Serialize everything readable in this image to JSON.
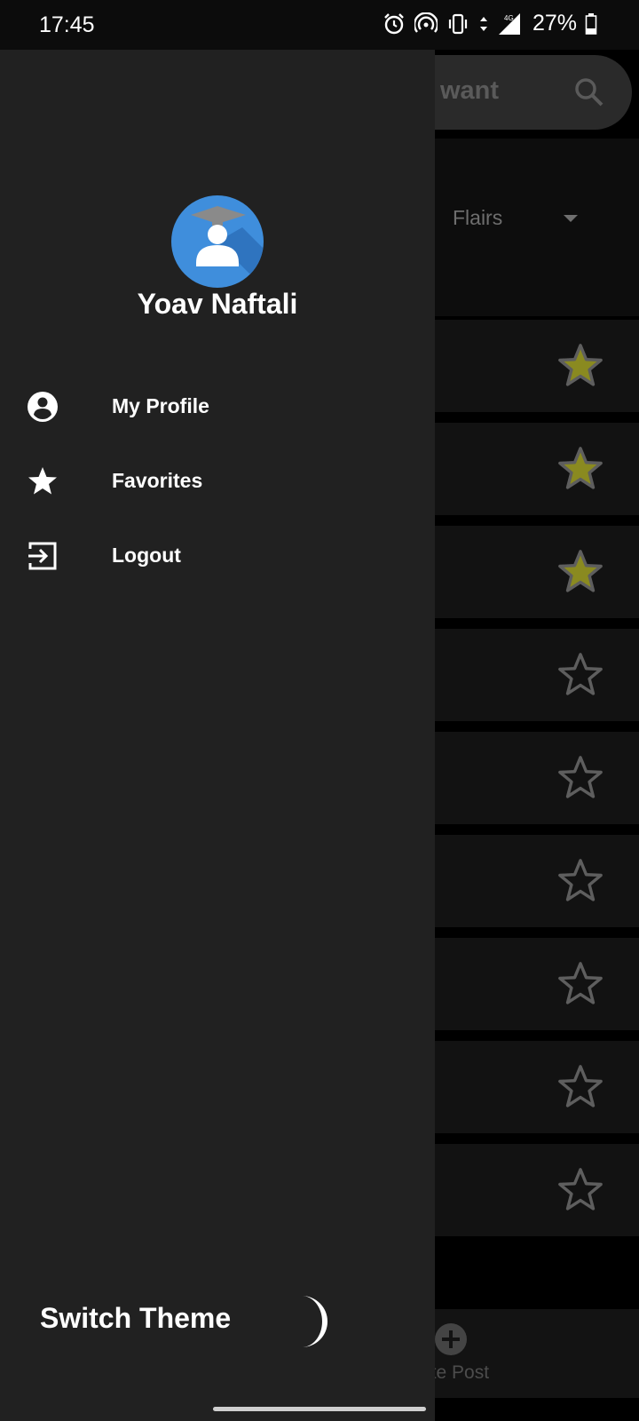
{
  "status_bar": {
    "time": "17:45",
    "network": "4G",
    "battery": "27%",
    "icons": [
      "alarm-icon",
      "hotspot-icon",
      "vibrate-icon",
      "data-arrows-icon",
      "signal-icon",
      "battery-icon"
    ]
  },
  "background": {
    "search_text": "want",
    "filter_label": "Flairs",
    "rows": [
      {
        "favorite": true
      },
      {
        "favorite": true
      },
      {
        "favorite": true
      },
      {
        "favorite": false
      },
      {
        "favorite": false
      },
      {
        "favorite": false
      },
      {
        "favorite": false
      },
      {
        "favorite": false
      },
      {
        "favorite": false
      }
    ],
    "bottom_nav_label": "ate Post"
  },
  "drawer": {
    "user_name": "Yoav Naftali",
    "menu": [
      {
        "label": "My Profile",
        "icon": "account-circle-icon"
      },
      {
        "label": "Favorites",
        "icon": "star-icon"
      },
      {
        "label": "Logout",
        "icon": "logout-icon"
      }
    ],
    "switch_theme_label": "Switch Theme",
    "theme_icon": "moon-icon"
  },
  "colors": {
    "drawer_bg": "#212121",
    "avatar_bg": "#3f8edc",
    "favorite_star": "#8a8a20",
    "inactive_star": "#5e5e5e"
  }
}
